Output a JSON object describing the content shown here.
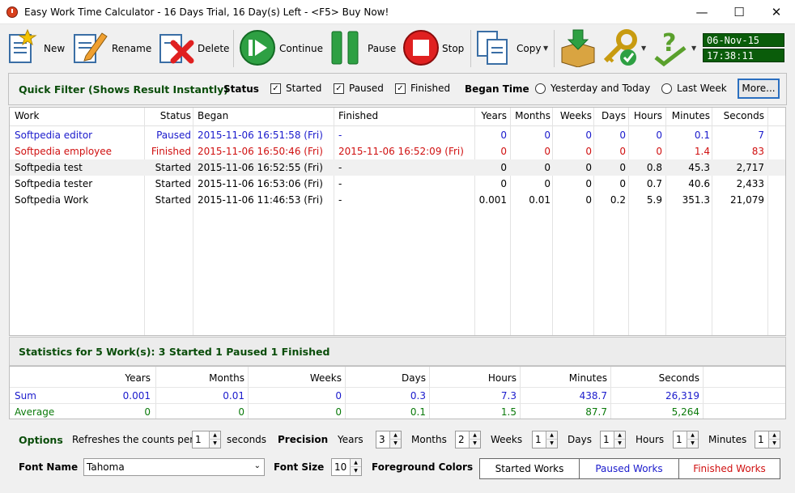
{
  "window": {
    "title": "Easy Work Time Calculator - 16 Days Trial, 16 Day(s) Left  - <F5> Buy Now!",
    "minimize": "—",
    "maximize": "☐",
    "close": "✕"
  },
  "toolbar": {
    "new": "New",
    "rename": "Rename",
    "delete": "Delete",
    "continue": "Continue",
    "pause": "Pause",
    "stop": "Stop",
    "copy": "Copy",
    "date": "06-Nov-15",
    "time": "17:38:11"
  },
  "filter": {
    "title": "Quick Filter (Shows Result Instantly)",
    "status_label": "Status",
    "started": "Started",
    "paused": "Paused",
    "finished": "Finished",
    "began_time_label": "Began Time",
    "yesterday_today": "Yesterday and Today",
    "last_week": "Last Week",
    "more": "More..."
  },
  "table": {
    "headers": [
      "Work",
      "Status",
      "Began",
      "Finished",
      "Years",
      "Months",
      "Weeks",
      "Days",
      "Hours",
      "Minutes",
      "Seconds"
    ],
    "rows": [
      {
        "work": "Softpedia editor",
        "status": "Paused",
        "began": "2015-11-06 16:51:58 (Fri)",
        "finished": "-",
        "years": "0",
        "months": "0",
        "weeks": "0",
        "days": "0",
        "hours": "0",
        "minutes": "0.1",
        "seconds": "7",
        "color": "#1a1acc"
      },
      {
        "work": "Softpedia employee",
        "status": "Finished",
        "began": "2015-11-06 16:50:46 (Fri)",
        "finished": "2015-11-06 16:52:09 (Fri)",
        "years": "0",
        "months": "0",
        "weeks": "0",
        "days": "0",
        "hours": "0",
        "minutes": "1.4",
        "seconds": "83",
        "color": "#d01010"
      },
      {
        "work": "Softpedia test",
        "status": "Started",
        "began": "2015-11-06 16:52:55 (Fri)",
        "finished": "-",
        "years": "0",
        "months": "0",
        "weeks": "0",
        "days": "0",
        "hours": "0.8",
        "minutes": "45.3",
        "seconds": "2,717",
        "color": "#000000"
      },
      {
        "work": "Softpedia tester",
        "status": "Started",
        "began": "2015-11-06 16:53:06 (Fri)",
        "finished": "-",
        "years": "0",
        "months": "0",
        "weeks": "0",
        "days": "0",
        "hours": "0.7",
        "minutes": "40.6",
        "seconds": "2,433",
        "color": "#000000"
      },
      {
        "work": "Softpedia Work",
        "status": "Started",
        "began": "2015-11-06 11:46:53 (Fri)",
        "finished": "-",
        "years": "0.001",
        "months": "0.01",
        "weeks": "0",
        "days": "0.2",
        "hours": "5.9",
        "minutes": "351.3",
        "seconds": "21,079",
        "color": "#000000"
      }
    ]
  },
  "stats": {
    "title": "Statistics for 5 Work(s): 3 Started 1 Paused 1 Finished",
    "headers": [
      "Years",
      "Months",
      "Weeks",
      "Days",
      "Hours",
      "Minutes",
      "Seconds"
    ],
    "sum_label": "Sum",
    "sum": [
      "0.001",
      "0.01",
      "0",
      "0.3",
      "7.3",
      "438.7",
      "26,319"
    ],
    "avg_label": "Average",
    "avg": [
      "0",
      "0",
      "0",
      "0.1",
      "1.5",
      "87.7",
      "5,264"
    ]
  },
  "options": {
    "title": "Options",
    "refresh_label": "Refreshes the counts per",
    "refresh_value": "1",
    "seconds_label": "seconds",
    "precision_label": "Precision",
    "years": "Years",
    "years_value": "3",
    "months": "Months",
    "months_value": "2",
    "weeks": "Weeks",
    "weeks_value": "1",
    "days": "Days",
    "days_value": "1",
    "hours": "Hours",
    "hours_value": "1",
    "minutes": "Minutes",
    "minutes_value": "1",
    "font_name_label": "Font Name",
    "font_name_value": "Tahoma",
    "font_size_label": "Font Size",
    "font_size_value": "10",
    "fg_colors_label": "Foreground Colors",
    "started_works": "Started Works",
    "paused_works": "Paused Works",
    "finished_works": "Finished Works"
  },
  "colors": {
    "started": "#000000",
    "paused": "#1a1acc",
    "finished": "#d01010",
    "sum": "#1a1acc",
    "average": "#0a7a0a",
    "accent": "#0a5c0a"
  }
}
